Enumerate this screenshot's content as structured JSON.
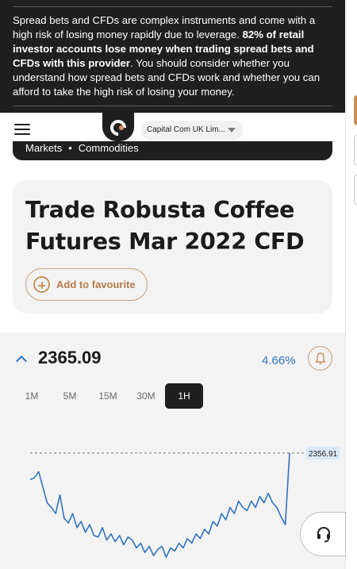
{
  "risk_warning": {
    "part1": "Spread bets and CFDs are complex instruments and come with a high risk of losing money rapidly due to leverage. ",
    "bold": "82% of retail investor accounts lose money when trading spread bets and CFDs with this provider",
    "part2": ". You should consider whether you understand how spread bets and CFDs work and whether you can afford to take the high risk of losing your money."
  },
  "header": {
    "entity_select": "Capital Com UK Lim..."
  },
  "breadcrumb": {
    "items": [
      "Markets",
      "Commodities"
    ],
    "separator": "•"
  },
  "title_card": {
    "title": "Trade Robusta Coffee Futures Mar 2022 CFD",
    "favourite_label": "Add to favourite"
  },
  "quote": {
    "price": "2365.09",
    "change": "4.66%"
  },
  "timeframes": [
    "1M",
    "5M",
    "15M",
    "30M",
    "1H"
  ],
  "active_timeframe": "1H",
  "chart_data": {
    "type": "line",
    "last_price_label": "2356.91",
    "values": [
      2340,
      2341,
      2345,
      2335,
      2325,
      2322,
      2318,
      2330,
      2315,
      2312,
      2318,
      2309,
      2313,
      2306,
      2311,
      2304,
      2303,
      2309,
      2301,
      2305,
      2300,
      2304,
      2298,
      2303,
      2301,
      2296,
      2299,
      2293,
      2297,
      2291,
      2295,
      2297,
      2290,
      2296,
      2294,
      2299,
      2296,
      2302,
      2299,
      2305,
      2302,
      2308,
      2305,
      2313,
      2310,
      2318,
      2314,
      2322,
      2318,
      2326,
      2322,
      2320,
      2326,
      2322,
      2329,
      2325,
      2331,
      2325,
      2322,
      2316,
      2311,
      2356.91
    ],
    "colors": {
      "line": "#2f73c0",
      "reference": "#7a7a7a",
      "label_bg": "#dbe8f7"
    }
  },
  "colors": {
    "accent": "#c9915a",
    "dark": "#1f1f1f",
    "price_change": "#2f73c0"
  },
  "icons": {
    "menu": "hamburger-icon",
    "favourite": "plus-circle-icon",
    "alert": "bell-icon",
    "support": "headset-icon",
    "direction": "chevron-up-icon"
  }
}
